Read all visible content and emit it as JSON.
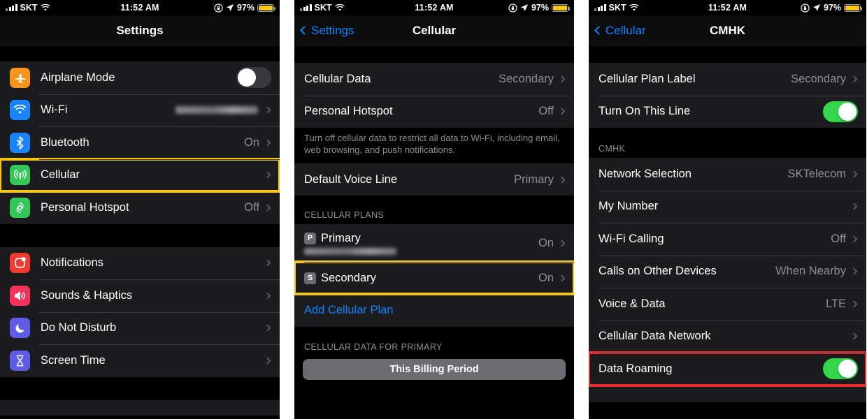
{
  "status_bar": {
    "carrier": "SKT",
    "time": "11:52 AM",
    "battery_percent": "97%",
    "wifi_icon": "wifi-icon",
    "signal_icon": "signal-bars-icon",
    "rotation_lock_icon": "rotation-lock-icon",
    "location_icon": "location-arrow-icon",
    "battery_icon": "battery-low-power-icon",
    "battery_color": "#f6c915"
  },
  "panel1": {
    "nav": {
      "title": "Settings"
    },
    "group1": [
      {
        "label": "Airplane Mode",
        "icon": "airplane-icon",
        "icon_color": "#f7941e",
        "accessory": "toggle",
        "toggle_on": false
      },
      {
        "label": "Wi-Fi",
        "icon": "wifi-icon",
        "icon_color": "#1a84ff",
        "accessory": "chevron",
        "value": "",
        "value_redacted": true
      },
      {
        "label": "Bluetooth",
        "icon": "bluetooth-icon",
        "icon_color": "#1a84ff",
        "accessory": "chevron",
        "value": "On"
      },
      {
        "label": "Cellular",
        "icon": "cellular-antenna-icon",
        "icon_color": "#34c759",
        "accessory": "chevron",
        "value": "",
        "highlight": "yellow"
      },
      {
        "label": "Personal Hotspot",
        "icon": "personal-hotspot-icon",
        "icon_color": "#34c759",
        "accessory": "chevron",
        "value": "Off"
      }
    ],
    "group2": [
      {
        "label": "Notifications",
        "icon": "notifications-icon",
        "icon_color": "#f23b2f",
        "accessory": "chevron"
      },
      {
        "label": "Sounds & Haptics",
        "icon": "sounds-haptics-icon",
        "icon_color": "#f4325a",
        "accessory": "chevron"
      },
      {
        "label": "Do Not Disturb",
        "icon": "do-not-disturb-moon-icon",
        "icon_color": "#5e5ce6",
        "accessory": "chevron"
      },
      {
        "label": "Screen Time",
        "icon": "screen-time-hourglass-icon",
        "icon_color": "#5e5ce6",
        "accessory": "chevron"
      }
    ]
  },
  "panel2": {
    "nav": {
      "back_label": "Settings",
      "title": "Cellular"
    },
    "group1": [
      {
        "label": "Cellular Data",
        "value": "Secondary",
        "accessory": "chevron"
      },
      {
        "label": "Personal Hotspot",
        "value": "Off",
        "accessory": "chevron"
      }
    ],
    "footnote1": "Turn off cellular data to restrict all data to Wi-Fi, including email, web browsing, and push notifications.",
    "group2": [
      {
        "label": "Default Voice Line",
        "value": "Primary",
        "accessory": "chevron"
      }
    ],
    "plans_header": "CELLULAR PLANS",
    "plans": [
      {
        "badge": "P",
        "label": "Primary",
        "subtitle_redacted": true,
        "value": "On",
        "accessory": "chevron"
      },
      {
        "badge": "S",
        "label": "Secondary",
        "value": "On",
        "accessory": "chevron",
        "highlight": "yellow"
      }
    ],
    "add_plan_label": "Add Cellular Plan",
    "data_header": "CELLULAR DATA FOR PRIMARY",
    "segment_label": "This Billing Period"
  },
  "panel3": {
    "nav": {
      "back_label": "Cellular",
      "title": "CMHK"
    },
    "group1": [
      {
        "label": "Cellular Plan Label",
        "value": "Secondary",
        "accessory": "chevron"
      },
      {
        "label": "Turn On This Line",
        "accessory": "toggle",
        "toggle_on": true
      }
    ],
    "section_header": "CMHK",
    "group2": [
      {
        "label": "Network Selection",
        "value": "SKTelecom",
        "accessory": "chevron"
      },
      {
        "label": "My Number",
        "value": "",
        "accessory": "chevron"
      },
      {
        "label": "Wi-Fi Calling",
        "value": "Off",
        "accessory": "chevron"
      },
      {
        "label": "Calls on Other Devices",
        "value": "When Nearby",
        "accessory": "chevron"
      },
      {
        "label": "Voice & Data",
        "value": "LTE",
        "accessory": "chevron"
      },
      {
        "label": "Cellular Data Network",
        "value": "",
        "accessory": "chevron"
      },
      {
        "label": "Data Roaming",
        "accessory": "toggle",
        "toggle_on": true,
        "highlight": "red"
      }
    ]
  },
  "colors": {
    "highlight_yellow": "#f5c518",
    "highlight_red": "#f22d2d",
    "accent_blue": "#0a84ff",
    "toggle_on_green": "#32d74b",
    "row_background": "#1c1c1e",
    "page_background": "#000000"
  }
}
